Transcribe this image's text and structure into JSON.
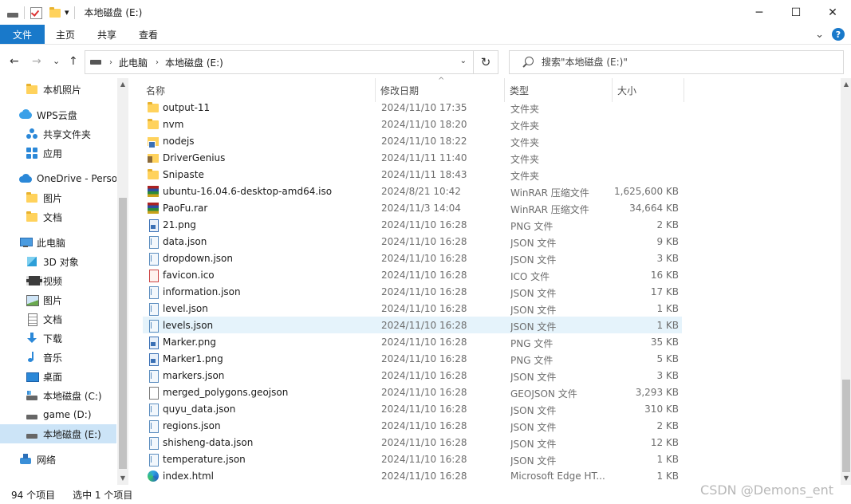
{
  "window": {
    "title": "本地磁盘 (E:)",
    "quick_access_dropdown": "▾",
    "controls": {
      "minimize": "─",
      "maximize": "☐",
      "close": "✕"
    }
  },
  "ribbon": {
    "tabs": [
      "文件",
      "主页",
      "共享",
      "查看"
    ],
    "expand": "⌄",
    "help": "?"
  },
  "nav": {
    "back": "←",
    "forward": "→",
    "recent": "⌄",
    "up": "↑",
    "breadcrumb": [
      "此电脑",
      "本地磁盘 (E:)"
    ],
    "breadcrumb_sep": "›",
    "dropdown": "⌄",
    "refresh": "↻",
    "search_placeholder": "搜索\"本地磁盘 (E:)\""
  },
  "sidebar": {
    "items": [
      {
        "label": "本机照片",
        "icon": "folder-icon",
        "indent": 1
      },
      {
        "label": "WPS云盘",
        "icon": "cloud-icon",
        "indent": 0
      },
      {
        "label": "共享文件夹",
        "icon": "share-icon",
        "indent": 1
      },
      {
        "label": "应用",
        "icon": "apps-icon",
        "indent": 1
      },
      {
        "label": "OneDrive - Perso",
        "icon": "onedrive-icon",
        "indent": 0
      },
      {
        "label": "图片",
        "icon": "folder-icon",
        "indent": 1
      },
      {
        "label": "文档",
        "icon": "folder-icon",
        "indent": 1
      },
      {
        "label": "此电脑",
        "icon": "computer-icon",
        "indent": 0
      },
      {
        "label": "3D 对象",
        "icon": "cube-icon",
        "indent": 1
      },
      {
        "label": "视频",
        "icon": "video-icon",
        "indent": 1
      },
      {
        "label": "图片",
        "icon": "picture-icon",
        "indent": 1
      },
      {
        "label": "文档",
        "icon": "document-icon",
        "indent": 1
      },
      {
        "label": "下载",
        "icon": "download-icon",
        "indent": 1
      },
      {
        "label": "音乐",
        "icon": "music-icon",
        "indent": 1
      },
      {
        "label": "桌面",
        "icon": "desktop-icon",
        "indent": 1
      },
      {
        "label": "本地磁盘 (C:)",
        "icon": "system-drive-icon",
        "indent": 1
      },
      {
        "label": "game (D:)",
        "icon": "drive-icon",
        "indent": 1
      },
      {
        "label": "本地磁盘 (E:)",
        "icon": "drive-icon",
        "indent": 1,
        "selected": true
      },
      {
        "label": "网络",
        "icon": "network-icon",
        "indent": 0
      }
    ],
    "scroll_up": "▲",
    "scroll_down": "▼"
  },
  "columns": {
    "name": "名称",
    "date": "修改日期",
    "type": "类型",
    "size": "大小",
    "sort_indicator": "^"
  },
  "files": [
    {
      "name": "output-11",
      "date": "2024/11/10 17:35",
      "type": "文件夹",
      "size": "",
      "icon": "folder-icon"
    },
    {
      "name": "nvm",
      "date": "2024/11/10 18:20",
      "type": "文件夹",
      "size": "",
      "icon": "folder-icon"
    },
    {
      "name": "nodejs",
      "date": "2024/11/10 18:22",
      "type": "文件夹",
      "size": "",
      "icon": "shortcut-folder-icon"
    },
    {
      "name": "DriverGenius",
      "date": "2024/11/11 11:40",
      "type": "文件夹",
      "size": "",
      "icon": "app-folder-icon"
    },
    {
      "name": "Snipaste",
      "date": "2024/11/11 18:43",
      "type": "文件夹",
      "size": "",
      "icon": "folder-icon"
    },
    {
      "name": "ubuntu-16.04.6-desktop-amd64.iso",
      "date": "2024/8/21 10:42",
      "type": "WinRAR 压缩文件",
      "size": "1,625,600 KB",
      "icon": "winrar-icon"
    },
    {
      "name": "PaoFu.rar",
      "date": "2024/11/3 14:04",
      "type": "WinRAR 压缩文件",
      "size": "34,664 KB",
      "icon": "winrar-icon"
    },
    {
      "name": "21.png",
      "date": "2024/11/10 16:28",
      "type": "PNG 文件",
      "size": "2 KB",
      "icon": "png-icon"
    },
    {
      "name": "data.json",
      "date": "2024/11/10 16:28",
      "type": "JSON 文件",
      "size": "9 KB",
      "icon": "json-icon"
    },
    {
      "name": "dropdown.json",
      "date": "2024/11/10 16:28",
      "type": "JSON 文件",
      "size": "3 KB",
      "icon": "json-icon"
    },
    {
      "name": "favicon.ico",
      "date": "2024/11/10 16:28",
      "type": "ICO 文件",
      "size": "16 KB",
      "icon": "ico-file-icon"
    },
    {
      "name": "information.json",
      "date": "2024/11/10 16:28",
      "type": "JSON 文件",
      "size": "17 KB",
      "icon": "json-icon"
    },
    {
      "name": "level.json",
      "date": "2024/11/10 16:28",
      "type": "JSON 文件",
      "size": "1 KB",
      "icon": "json-icon"
    },
    {
      "name": "levels.json",
      "date": "2024/11/10 16:28",
      "type": "JSON 文件",
      "size": "1 KB",
      "icon": "json-icon",
      "selected": true
    },
    {
      "name": "Marker.png",
      "date": "2024/11/10 16:28",
      "type": "PNG 文件",
      "size": "35 KB",
      "icon": "png-icon"
    },
    {
      "name": "Marker1.png",
      "date": "2024/11/10 16:28",
      "type": "PNG 文件",
      "size": "5 KB",
      "icon": "png-icon"
    },
    {
      "name": "markers.json",
      "date": "2024/11/10 16:28",
      "type": "JSON 文件",
      "size": "3 KB",
      "icon": "json-icon"
    },
    {
      "name": "merged_polygons.geojson",
      "date": "2024/11/10 16:28",
      "type": "GEOJSON 文件",
      "size": "3,293 KB",
      "icon": "file-icon"
    },
    {
      "name": "quyu_data.json",
      "date": "2024/11/10 16:28",
      "type": "JSON 文件",
      "size": "310 KB",
      "icon": "json-icon"
    },
    {
      "name": "regions.json",
      "date": "2024/11/10 16:28",
      "type": "JSON 文件",
      "size": "2 KB",
      "icon": "json-icon"
    },
    {
      "name": "shisheng-data.json",
      "date": "2024/11/10 16:28",
      "type": "JSON 文件",
      "size": "12 KB",
      "icon": "json-icon"
    },
    {
      "name": "temperature.json",
      "date": "2024/11/10 16:28",
      "type": "JSON 文件",
      "size": "1 KB",
      "icon": "json-icon"
    },
    {
      "name": "index.html",
      "date": "2024/11/10 16:28",
      "type": "Microsoft Edge HT...",
      "size": "1 KB",
      "icon": "edge-icon"
    }
  ],
  "status": {
    "item_count": "94 个项目",
    "selected": "选中 1 个项目"
  },
  "watermark": "CSDN @Demons_ent"
}
